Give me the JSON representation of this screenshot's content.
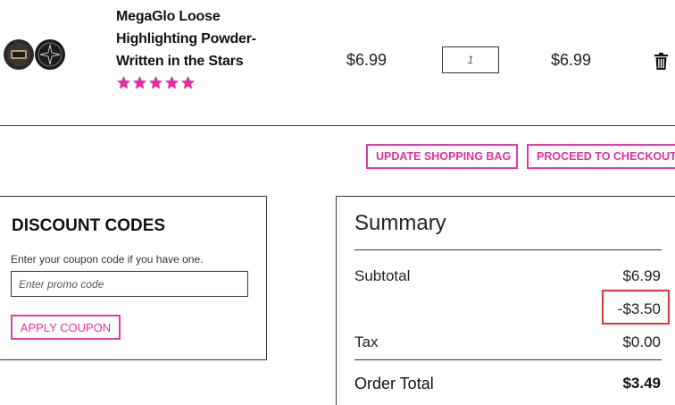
{
  "product": {
    "name": "MegaGlo Loose Highlighting Powder-Written in the Stars",
    "rating_stars": 5,
    "unit_price": "$6.99",
    "quantity": "1",
    "line_total": "$6.99"
  },
  "actions": {
    "update_label": "UPDATE SHOPPING BAG",
    "checkout_label": "PROCEED TO CHECKOUT"
  },
  "discount": {
    "title": "DISCOUNT CODES",
    "hint": "Enter your coupon code if you have one.",
    "placeholder": "Enter promo code",
    "apply_label": "APPLY COUPON"
  },
  "summary": {
    "title": "Summary",
    "subtotal_label": "Subtotal",
    "subtotal_value": "$6.99",
    "discount_value": "-$3.50",
    "tax_label": "Tax",
    "tax_value": "$0.00",
    "total_label": "Order Total",
    "total_value": "$3.49"
  },
  "colors": {
    "accent": "#e0319f",
    "highlight_box": "#e0353a"
  },
  "icons": {
    "delete": "trash-icon",
    "chevron": "chevron-right-icon",
    "rating": "star-icon"
  }
}
